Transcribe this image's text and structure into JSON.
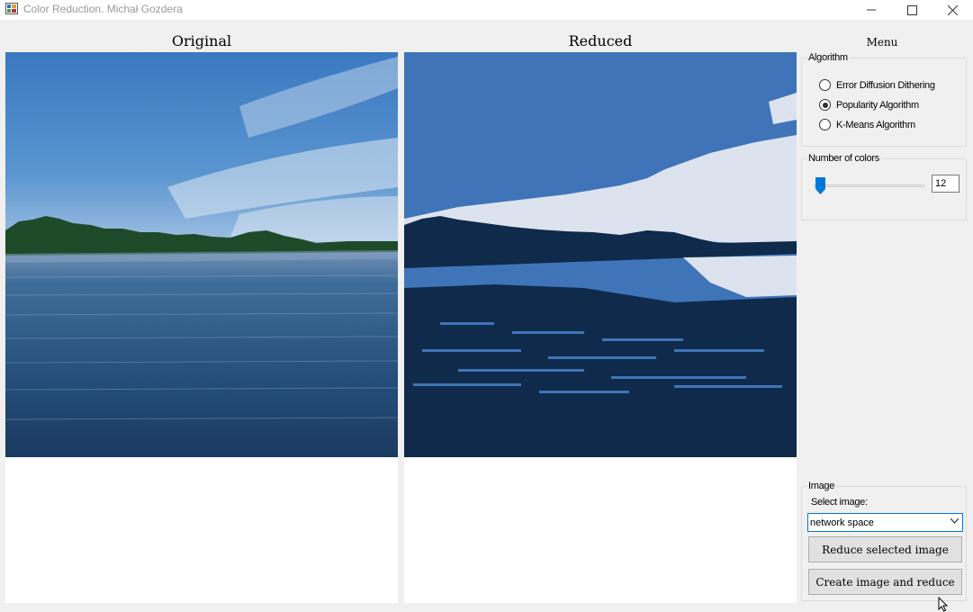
{
  "window": {
    "title": "Color Reduction. Michał Gozdera",
    "icons": {
      "app": "app-icon",
      "minimize": "minimize-icon",
      "maximize": "maximize-icon",
      "close": "close-icon"
    }
  },
  "panels": {
    "original_title": "Original",
    "reduced_title": "Reduced"
  },
  "menu": {
    "title": "Menu",
    "algorithm": {
      "legend": "Algorithm",
      "options": [
        {
          "label": "Error Diffusion Dithering",
          "selected": false
        },
        {
          "label": "Popularity Algorithm",
          "selected": true
        },
        {
          "label": "K-Means Algorithm",
          "selected": false
        }
      ]
    },
    "colors": {
      "legend": "Number of colors",
      "value": "12",
      "slider_level": 0.05
    },
    "image": {
      "legend": "Image",
      "select_label": "Select image:",
      "selected_value": "network space",
      "reduce_button": "Reduce selected image",
      "create_button": "Create image and reduce"
    }
  },
  "colors": {
    "background": "#f0f0f0",
    "accent": "#0078d7",
    "sky_original": "#3d7fc4",
    "water_original": "#1d4570",
    "reduced_dark": "#0f2a4a",
    "reduced_mid": "#3f74b8",
    "reduced_light": "#dde3ee"
  }
}
